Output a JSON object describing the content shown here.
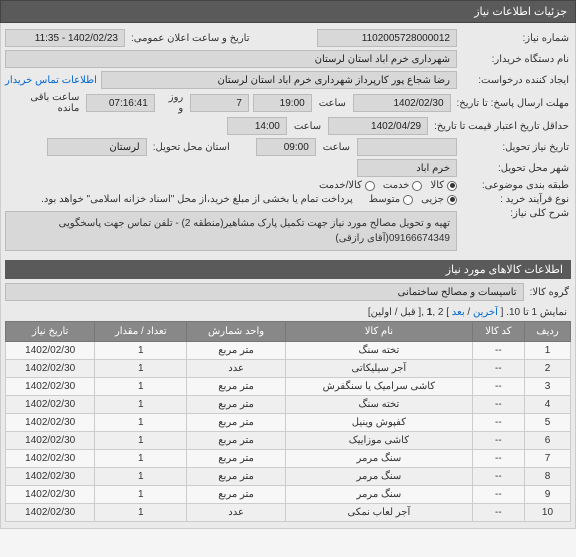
{
  "panel_title": "جزئیات اطلاعات نیاز",
  "fields": {
    "req_no_label": "شماره نیاز:",
    "req_no": "1102005728000012",
    "buyer_label": "نام دستگاه خریدار:",
    "buyer": "شهرداری خرم اباد استان لرستان",
    "requester_label": "ایجاد کننده درخواست:",
    "requester": "رضا شجاع پور کارپرداز شهرداری خرم اباد استان لرستان",
    "contact_link": "اطلاعات تماس خریدار",
    "announce_label": "تاریخ و ساعت اعلان عمومی:",
    "announce_date": "1402/02/23 - 11:35",
    "deadline_label": "مهلت ارسال پاسخ: تا تاریخ:",
    "deadline_date": "1402/02/30",
    "hour_label": "ساعت",
    "deadline_hour": "19:00",
    "days_remain": "7",
    "days_and": "روز و",
    "time_remain": "07:16:41",
    "time_remain_label": "ساعت باقی مانده",
    "validity_label": "حداقل تاریخ اعتبار قیمت تا تاریخ:",
    "validity_date": "1402/04/29",
    "validity_hour": "14:00",
    "delivery_date_label": "تاریخ نیاز تحویل:",
    "delivery_hour": "09:00",
    "province_label": "استان محل تحویل:",
    "province": "لرستان",
    "city_label": "شهر محل تحویل:",
    "city": "خرم اباد",
    "category_label": "طبقه بندی موضوعی:",
    "cat_option1": "کالا",
    "cat_option2": "خدمت",
    "cat_option3": "کالا/خدمت",
    "purchase_type_label": "نوع فرآیند خرید :",
    "purchase_option1": "جزیی",
    "purchase_option2": "متوسط",
    "purchase_note": "پرداخت تمام یا بخشی از مبلغ خرید،از محل \"اسناد خزانه اسلامی\" خواهد بود.",
    "desc_label": "شرح کلی نیاز:",
    "desc": "تهیه و تحویل مصالح مورد نیاز جهت تکمیل پارک مشاهیر(منطقه 2) - تلفن تماس جهت پاسخگویی 09166674349(آقای رازقی)"
  },
  "items_header": "اطلاعات کالاهای مورد نیاز",
  "group_label": "گروه کالا:",
  "group_value": "تاسیسات و مصالح ساختمانی",
  "pager": {
    "text_prefix": "نمایش 1 تا 10. [ ",
    "last": "آخرین",
    "sep": " / ",
    "next": "بعد",
    "mid": " ] 2 ,",
    "one": "1",
    "text_suffix": " ,[ قبل / اولین]"
  },
  "columns": [
    "ردیف",
    "کد کالا",
    "نام کالا",
    "واحد شمارش",
    "تعداد / مقدار",
    "تاریخ نیاز"
  ],
  "rows": [
    {
      "n": "1",
      "code": "--",
      "name": "تخته سنگ",
      "unit": "متر مربع",
      "qty": "1",
      "date": "1402/02/30"
    },
    {
      "n": "2",
      "code": "--",
      "name": "آجر سیلیکاتی",
      "unit": "عدد",
      "qty": "1",
      "date": "1402/02/30"
    },
    {
      "n": "3",
      "code": "--",
      "name": "کاشی سرامیک یا سنگفرش",
      "unit": "متر مربع",
      "qty": "1",
      "date": "1402/02/30"
    },
    {
      "n": "4",
      "code": "--",
      "name": "تخته سنگ",
      "unit": "متر مربع",
      "qty": "1",
      "date": "1402/02/30"
    },
    {
      "n": "5",
      "code": "--",
      "name": "کفپوش وینیل",
      "unit": "متر مربع",
      "qty": "1",
      "date": "1402/02/30"
    },
    {
      "n": "6",
      "code": "--",
      "name": "کاشی موزاییک",
      "unit": "متر مربع",
      "qty": "1",
      "date": "1402/02/30"
    },
    {
      "n": "7",
      "code": "--",
      "name": "سنگ مرمر",
      "unit": "متر مربع",
      "qty": "1",
      "date": "1402/02/30"
    },
    {
      "n": "8",
      "code": "--",
      "name": "سنگ مرمر",
      "unit": "متر مربع",
      "qty": "1",
      "date": "1402/02/30"
    },
    {
      "n": "9",
      "code": "--",
      "name": "سنگ مرمر",
      "unit": "متر مربع",
      "qty": "1",
      "date": "1402/02/30"
    },
    {
      "n": "10",
      "code": "--",
      "name": "آجر لعاب نمکی",
      "unit": "عدد",
      "qty": "1",
      "date": "1402/02/30"
    }
  ]
}
